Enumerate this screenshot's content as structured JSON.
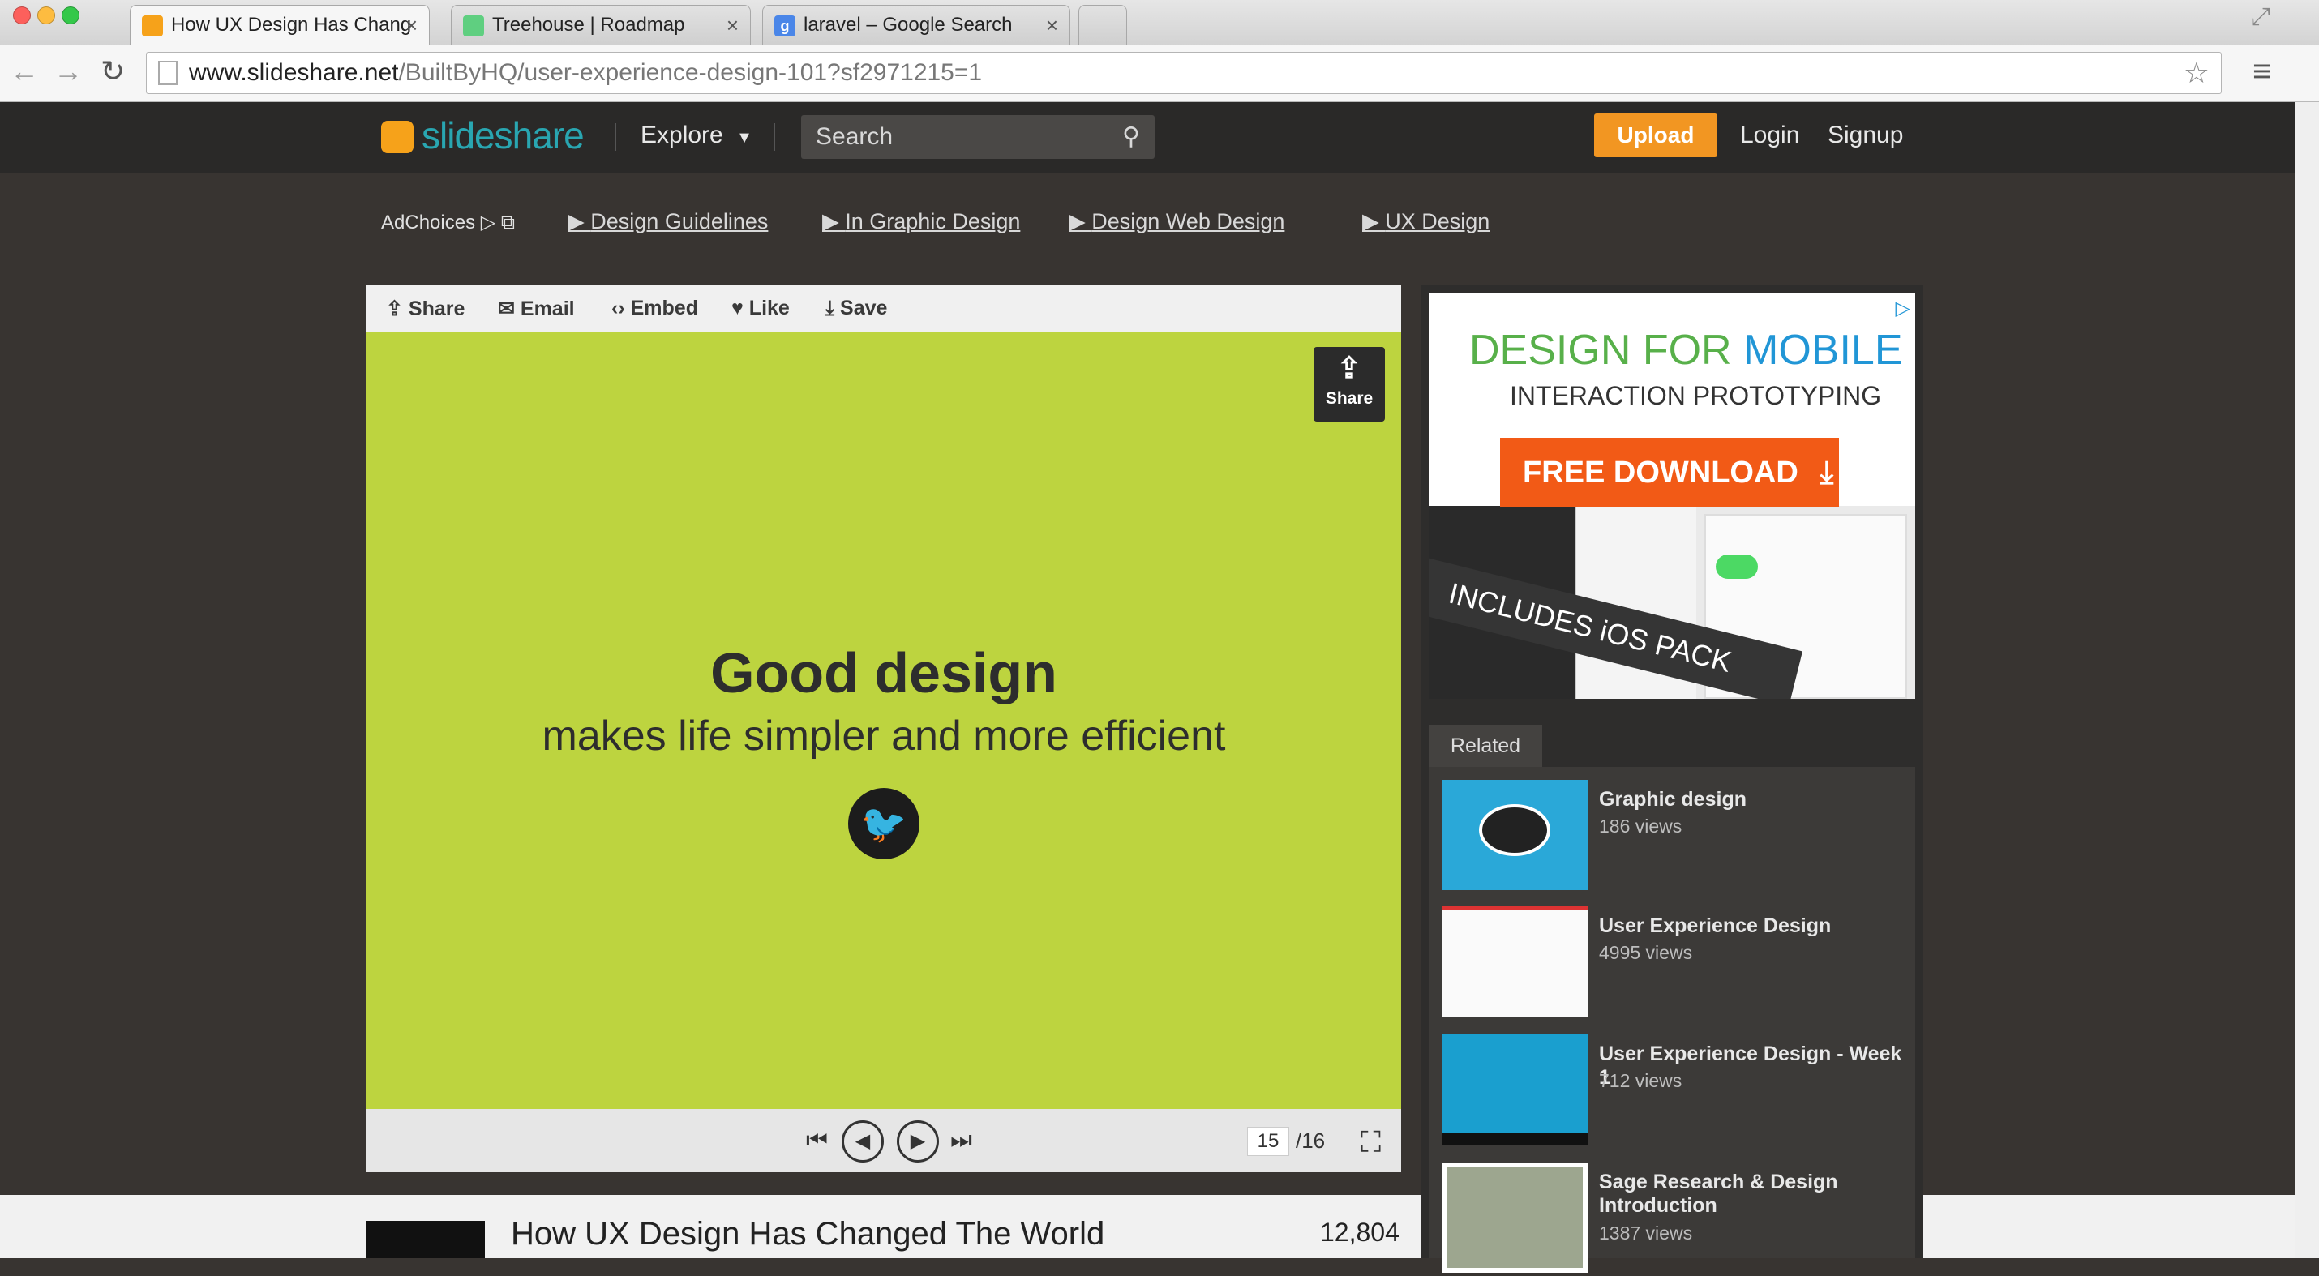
{
  "browser": {
    "tabs": [
      {
        "label": "How UX Design Has Chang",
        "active": true
      },
      {
        "label": "Treehouse | Roadmap",
        "active": false
      },
      {
        "label": "laravel – Google Search",
        "active": false
      }
    ],
    "url_host": "www.slideshare.net",
    "url_path": "/BuiltByHQ/user-experience-design-101?sf2971215=1"
  },
  "header": {
    "logo": "slideshare",
    "explore": "Explore",
    "search_placeholder": "Search",
    "upload": "Upload",
    "login": "Login",
    "signup": "Signup"
  },
  "ads_row": {
    "adchoices": "AdChoices",
    "links": [
      "Design Guidelines",
      "In Graphic Design",
      "Design Web Design",
      "UX Design"
    ]
  },
  "player": {
    "actions": [
      "Share",
      "Email",
      "Embed",
      "Like",
      "Save"
    ],
    "slide_title": "Good design",
    "slide_subtitle": "makes life simpler and more efficient",
    "share_overlay": "Share",
    "current_page": "15",
    "total_pages": "/16"
  },
  "document": {
    "title": "How UX Design Has Changed The World",
    "views": "12,804"
  },
  "ad": {
    "headline_a": "DESIGN FOR ",
    "headline_b": "MOBILE",
    "sub": "INTERACTION PROTOTYPING",
    "button": "FREE DOWNLOAD",
    "banner": "INCLUDES iOS PACK"
  },
  "related": {
    "tab": "Related",
    "items": [
      {
        "title": "Graphic design",
        "views": "186 views"
      },
      {
        "title": "User Experience Design",
        "views": "4995 views"
      },
      {
        "title": "User Experience Design - Week 1",
        "views": "712 views"
      },
      {
        "title": "Sage Research & Design Introduction",
        "views": "1387 views"
      }
    ]
  },
  "colors": {
    "accent": "#f29622",
    "slide_bg": "#bdd43f",
    "site_bg": "#383431"
  }
}
